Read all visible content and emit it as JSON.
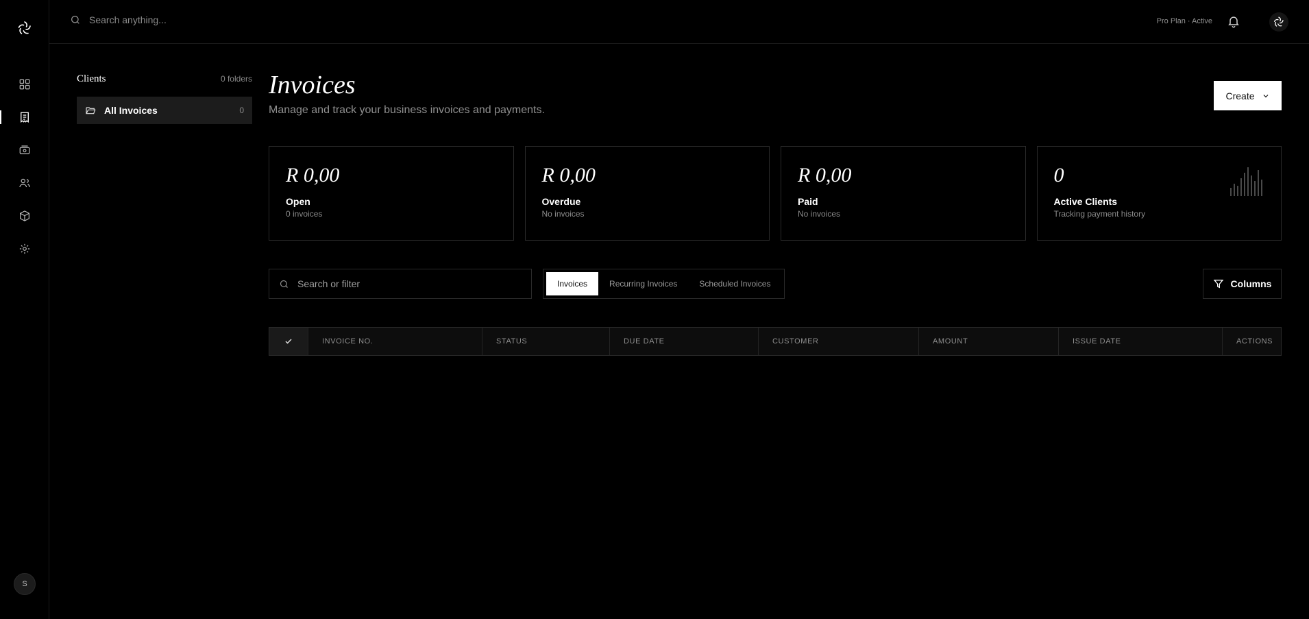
{
  "header": {
    "search_placeholder": "Search anything...",
    "plan": "Pro Plan · Active"
  },
  "rail": {
    "items": [
      {
        "icon": "dashboard-icon",
        "active": false
      },
      {
        "icon": "invoice-icon",
        "active": true
      },
      {
        "icon": "payments-icon",
        "active": false
      },
      {
        "icon": "users-icon",
        "active": false
      },
      {
        "icon": "box-icon",
        "active": false
      },
      {
        "icon": "gear-icon",
        "active": false
      }
    ],
    "avatar_initial": "S"
  },
  "clients": {
    "title": "Clients",
    "count": "0 folders",
    "folders": [
      {
        "label": "All Invoices",
        "count": "0"
      }
    ]
  },
  "page": {
    "title": "Invoices",
    "subtitle": "Manage and track your business invoices and payments.",
    "create_label": "Create"
  },
  "stats": [
    {
      "value": "R 0,00",
      "label": "Open",
      "sub": "0 invoices"
    },
    {
      "value": "R 0,00",
      "label": "Overdue",
      "sub": "No invoices"
    },
    {
      "value": "R 0,00",
      "label": "Paid",
      "sub": "No invoices"
    },
    {
      "value": "0",
      "label": "Active Clients",
      "sub": "Tracking payment history"
    }
  ],
  "filter": {
    "placeholder": "Search or filter"
  },
  "tabs": [
    {
      "label": "Invoices",
      "active": true
    },
    {
      "label": "Recurring Invoices",
      "active": false
    },
    {
      "label": "Scheduled Invoices",
      "active": false
    }
  ],
  "columns_label": "Columns",
  "table": {
    "headers": [
      "INVOICE NO.",
      "STATUS",
      "DUE DATE",
      "CUSTOMER",
      "AMOUNT",
      "ISSUE DATE",
      "ACTIONS"
    ]
  },
  "colors": {
    "accent": "#ffffff",
    "background": "#000000",
    "border": "#2a2a2a",
    "muted": "#8a8a8a"
  }
}
